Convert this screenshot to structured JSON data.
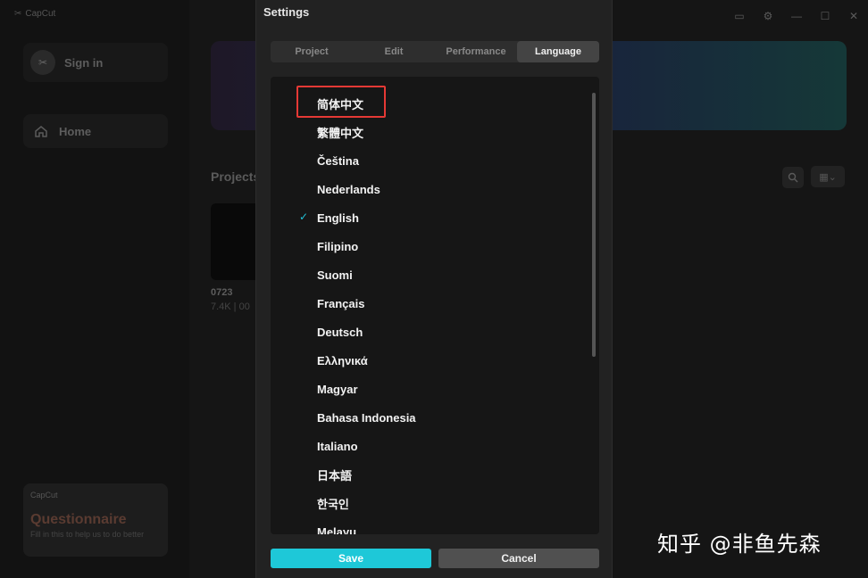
{
  "app": {
    "logo_text": "CapCut",
    "signin_label": "Sign in",
    "home_label": "Home",
    "projects_title": "Projects",
    "project": {
      "name": "0723",
      "meta": "7.4K | 00"
    },
    "questionnaire": {
      "logo": "CapCut",
      "title": "Questionnaire",
      "subtitle": "Fill in this to help us to do better"
    },
    "window_controls": [
      "feedback-icon",
      "settings-icon",
      "minimize-icon",
      "maximize-icon",
      "close-icon"
    ]
  },
  "settings": {
    "title": "Settings",
    "tabs": [
      {
        "label": "Project",
        "active": false
      },
      {
        "label": "Edit",
        "active": false
      },
      {
        "label": "Performance",
        "active": false
      },
      {
        "label": "Language",
        "active": true
      }
    ],
    "languages": [
      {
        "label": "简体中文",
        "selected": false,
        "highlighted": true
      },
      {
        "label": "繁體中文",
        "selected": false
      },
      {
        "label": "Čeština",
        "selected": false
      },
      {
        "label": "Nederlands",
        "selected": false
      },
      {
        "label": "English",
        "selected": true
      },
      {
        "label": "Filipino",
        "selected": false
      },
      {
        "label": "Suomi",
        "selected": false
      },
      {
        "label": "Français",
        "selected": false
      },
      {
        "label": "Deutsch",
        "selected": false
      },
      {
        "label": "Ελληνικά",
        "selected": false
      },
      {
        "label": "Magyar",
        "selected": false
      },
      {
        "label": "Bahasa Indonesia",
        "selected": false
      },
      {
        "label": "Italiano",
        "selected": false
      },
      {
        "label": "日本語",
        "selected": false
      },
      {
        "label": "한국인",
        "selected": false
      },
      {
        "label": "Melayu",
        "selected": false
      }
    ],
    "save_label": "Save",
    "cancel_label": "Cancel",
    "accent_color": "#1ec8d8",
    "highlight_color": "#e53935"
  },
  "watermark": "知乎 @非鱼先森"
}
